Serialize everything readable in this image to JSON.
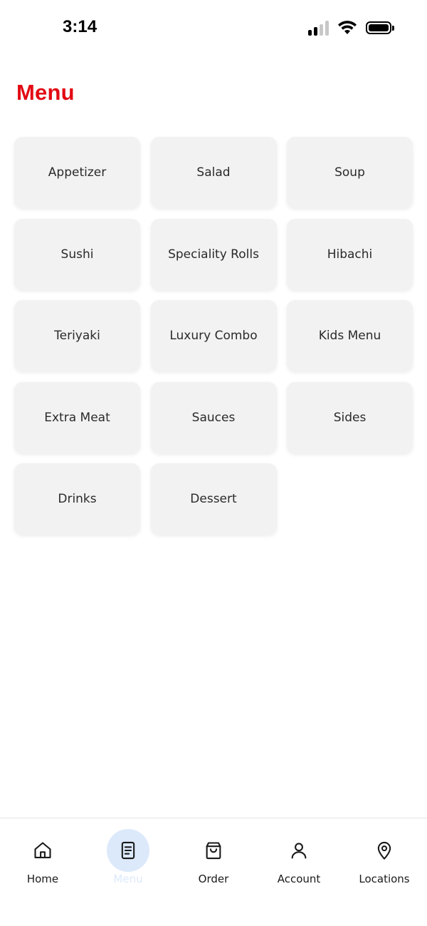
{
  "status_bar": {
    "time": "3:14",
    "icons": [
      "cellular-signal-icon",
      "wifi-icon",
      "battery-icon"
    ]
  },
  "header": {
    "title": "Menu"
  },
  "menu_categories": [
    {
      "label": "Appetizer"
    },
    {
      "label": "Salad"
    },
    {
      "label": "Soup"
    },
    {
      "label": "Sushi"
    },
    {
      "label": "Speciality Rolls"
    },
    {
      "label": "Hibachi"
    },
    {
      "label": "Teriyaki"
    },
    {
      "label": "Luxury Combo"
    },
    {
      "label": "Kids Menu"
    },
    {
      "label": "Extra Meat"
    },
    {
      "label": "Sauces"
    },
    {
      "label": "Sides"
    },
    {
      "label": "Drinks"
    },
    {
      "label": "Dessert"
    }
  ],
  "bottom_nav": {
    "active": "Menu",
    "items": [
      {
        "label": "Home",
        "icon": "home-icon"
      },
      {
        "label": "Menu",
        "icon": "menu-document-icon"
      },
      {
        "label": "Order",
        "icon": "shopping-bag-icon"
      },
      {
        "label": "Account",
        "icon": "user-icon"
      },
      {
        "label": "Locations",
        "icon": "map-pin-icon"
      }
    ]
  },
  "colors": {
    "title_red": "#e20a13",
    "card_background": "#f2f2f2",
    "active_nav_highlight": "#dce9fb"
  }
}
